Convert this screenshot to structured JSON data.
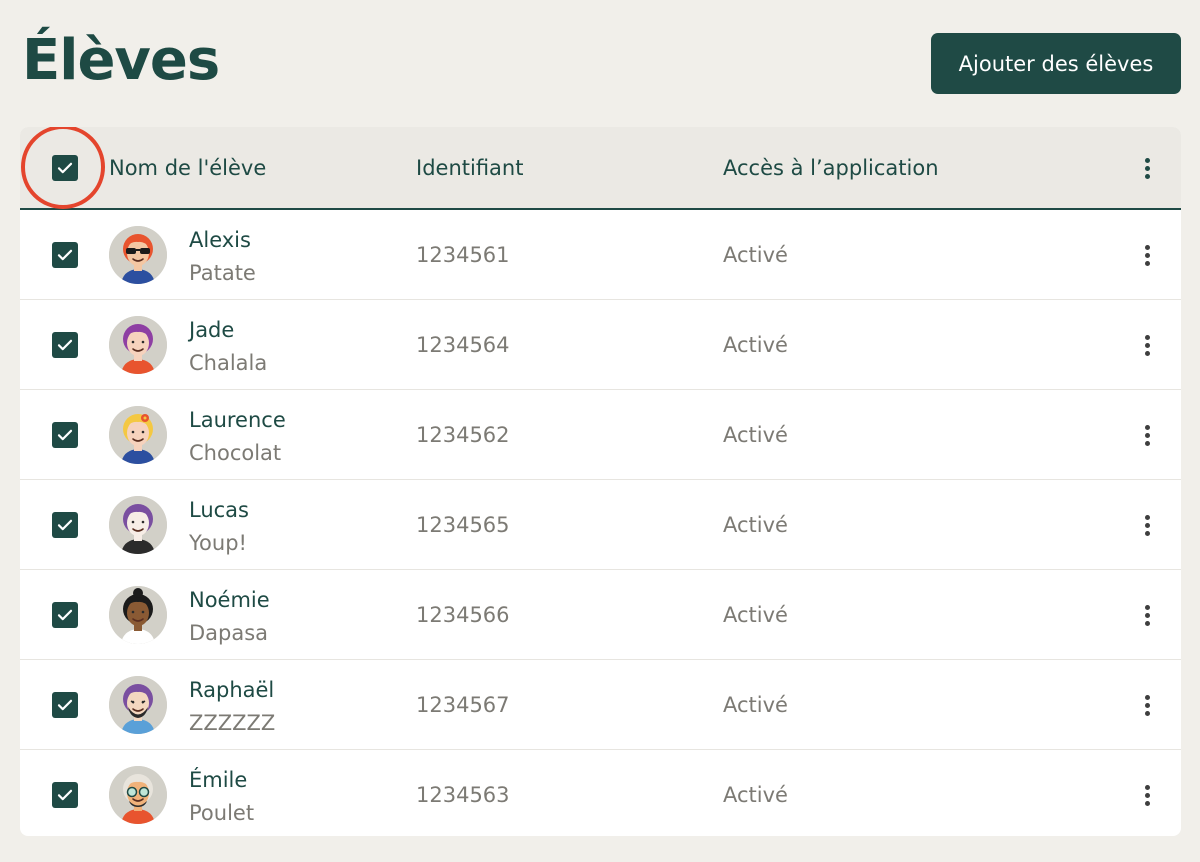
{
  "page": {
    "title": "Élèves",
    "add_button_label": "Ajouter des élèves"
  },
  "table": {
    "headers": {
      "name": "Nom de l'élève",
      "identifier": "Identifiant",
      "access": "Accès à l’application"
    },
    "select_all_checked": true,
    "rows": [
      {
        "name": "Alexis",
        "nickname": "Patate",
        "identifier": "1234561",
        "access": "Activé",
        "checked": true,
        "avatar": {
          "hair": "#e8542e",
          "skin": "#f4c7a3",
          "shirt": "#2c4fa0",
          "accessory": "sunglasses"
        }
      },
      {
        "name": "Jade",
        "nickname": "Chalala",
        "identifier": "1234564",
        "access": "Activé",
        "checked": true,
        "avatar": {
          "hair": "#8e3fa3",
          "skin": "#f6d2bd",
          "shirt": "#e8542e",
          "accessory": "none"
        }
      },
      {
        "name": "Laurence",
        "nickname": "Chocolat",
        "identifier": "1234562",
        "access": "Activé",
        "checked": true,
        "avatar": {
          "hair": "#f4c842",
          "skin": "#f6d2bd",
          "shirt": "#2c4fa0",
          "accessory": "flower"
        }
      },
      {
        "name": "Lucas",
        "nickname": "Youp!",
        "identifier": "1234565",
        "access": "Activé",
        "checked": true,
        "avatar": {
          "hair": "#7a4fa0",
          "skin": "#f7ede6",
          "shirt": "#2b2b2b",
          "accessory": "none"
        }
      },
      {
        "name": "Noémie",
        "nickname": "Dapasa",
        "identifier": "1234566",
        "access": "Activé",
        "checked": true,
        "avatar": {
          "hair": "#1b1b1b",
          "skin": "#8a5a34",
          "shirt": "#ffffff",
          "accessory": "bun"
        }
      },
      {
        "name": "Raphaël",
        "nickname": "ZZZZZZ",
        "identifier": "1234567",
        "access": "Activé",
        "checked": true,
        "avatar": {
          "hair": "#7a4fa0",
          "skin": "#f4d7c0",
          "shirt": "#5aa0d8",
          "accessory": "beard"
        }
      },
      {
        "name": "Émile",
        "nickname": "Poulet",
        "identifier": "1234563",
        "access": "Activé",
        "checked": true,
        "avatar": {
          "hair": "#e8e4dc",
          "skin": "#f0b27a",
          "shirt": "#e8542e",
          "accessory": "glasses"
        }
      }
    ]
  },
  "colors": {
    "primary": "#1f4a45",
    "background": "#f1efea",
    "header_bg": "#ebe9e4",
    "muted_text": "#7c7a74",
    "highlight": "#e4452d",
    "kebab_dot": "#3f3f3f"
  },
  "icons": {
    "checkbox": "check-icon",
    "row_menu": "kebab-menu-icon"
  }
}
